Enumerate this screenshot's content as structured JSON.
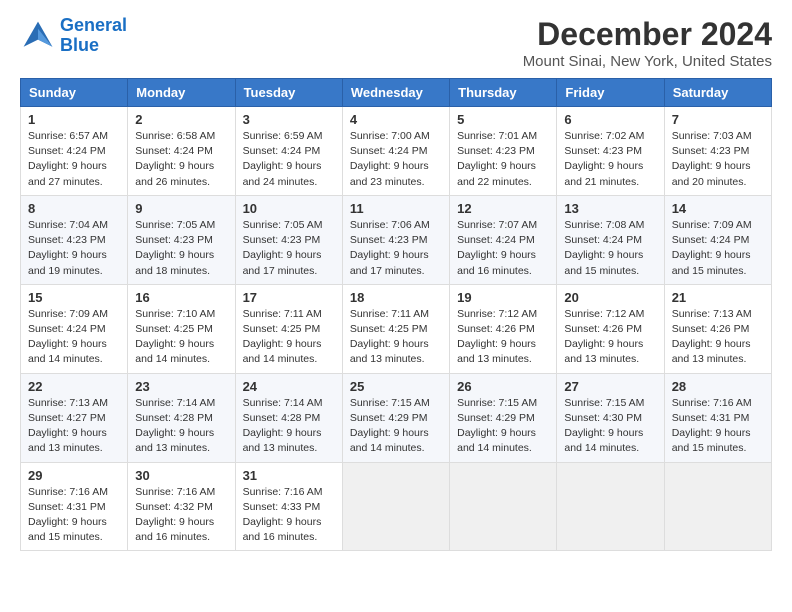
{
  "header": {
    "logo_line1": "General",
    "logo_line2": "Blue",
    "title": "December 2024",
    "subtitle": "Mount Sinai, New York, United States"
  },
  "calendar": {
    "days_of_week": [
      "Sunday",
      "Monday",
      "Tuesday",
      "Wednesday",
      "Thursday",
      "Friday",
      "Saturday"
    ],
    "weeks": [
      [
        {
          "day": "1",
          "sunrise": "6:57 AM",
          "sunset": "4:24 PM",
          "daylight": "9 hours and 27 minutes."
        },
        {
          "day": "2",
          "sunrise": "6:58 AM",
          "sunset": "4:24 PM",
          "daylight": "9 hours and 26 minutes."
        },
        {
          "day": "3",
          "sunrise": "6:59 AM",
          "sunset": "4:24 PM",
          "daylight": "9 hours and 24 minutes."
        },
        {
          "day": "4",
          "sunrise": "7:00 AM",
          "sunset": "4:24 PM",
          "daylight": "9 hours and 23 minutes."
        },
        {
          "day": "5",
          "sunrise": "7:01 AM",
          "sunset": "4:23 PM",
          "daylight": "9 hours and 22 minutes."
        },
        {
          "day": "6",
          "sunrise": "7:02 AM",
          "sunset": "4:23 PM",
          "daylight": "9 hours and 21 minutes."
        },
        {
          "day": "7",
          "sunrise": "7:03 AM",
          "sunset": "4:23 PM",
          "daylight": "9 hours and 20 minutes."
        }
      ],
      [
        {
          "day": "8",
          "sunrise": "7:04 AM",
          "sunset": "4:23 PM",
          "daylight": "9 hours and 19 minutes."
        },
        {
          "day": "9",
          "sunrise": "7:05 AM",
          "sunset": "4:23 PM",
          "daylight": "9 hours and 18 minutes."
        },
        {
          "day": "10",
          "sunrise": "7:05 AM",
          "sunset": "4:23 PM",
          "daylight": "9 hours and 17 minutes."
        },
        {
          "day": "11",
          "sunrise": "7:06 AM",
          "sunset": "4:23 PM",
          "daylight": "9 hours and 17 minutes."
        },
        {
          "day": "12",
          "sunrise": "7:07 AM",
          "sunset": "4:24 PM",
          "daylight": "9 hours and 16 minutes."
        },
        {
          "day": "13",
          "sunrise": "7:08 AM",
          "sunset": "4:24 PM",
          "daylight": "9 hours and 15 minutes."
        },
        {
          "day": "14",
          "sunrise": "7:09 AM",
          "sunset": "4:24 PM",
          "daylight": "9 hours and 15 minutes."
        }
      ],
      [
        {
          "day": "15",
          "sunrise": "7:09 AM",
          "sunset": "4:24 PM",
          "daylight": "9 hours and 14 minutes."
        },
        {
          "day": "16",
          "sunrise": "7:10 AM",
          "sunset": "4:25 PM",
          "daylight": "9 hours and 14 minutes."
        },
        {
          "day": "17",
          "sunrise": "7:11 AM",
          "sunset": "4:25 PM",
          "daylight": "9 hours and 14 minutes."
        },
        {
          "day": "18",
          "sunrise": "7:11 AM",
          "sunset": "4:25 PM",
          "daylight": "9 hours and 13 minutes."
        },
        {
          "day": "19",
          "sunrise": "7:12 AM",
          "sunset": "4:26 PM",
          "daylight": "9 hours and 13 minutes."
        },
        {
          "day": "20",
          "sunrise": "7:12 AM",
          "sunset": "4:26 PM",
          "daylight": "9 hours and 13 minutes."
        },
        {
          "day": "21",
          "sunrise": "7:13 AM",
          "sunset": "4:26 PM",
          "daylight": "9 hours and 13 minutes."
        }
      ],
      [
        {
          "day": "22",
          "sunrise": "7:13 AM",
          "sunset": "4:27 PM",
          "daylight": "9 hours and 13 minutes."
        },
        {
          "day": "23",
          "sunrise": "7:14 AM",
          "sunset": "4:28 PM",
          "daylight": "9 hours and 13 minutes."
        },
        {
          "day": "24",
          "sunrise": "7:14 AM",
          "sunset": "4:28 PM",
          "daylight": "9 hours and 13 minutes."
        },
        {
          "day": "25",
          "sunrise": "7:15 AM",
          "sunset": "4:29 PM",
          "daylight": "9 hours and 14 minutes."
        },
        {
          "day": "26",
          "sunrise": "7:15 AM",
          "sunset": "4:29 PM",
          "daylight": "9 hours and 14 minutes."
        },
        {
          "day": "27",
          "sunrise": "7:15 AM",
          "sunset": "4:30 PM",
          "daylight": "9 hours and 14 minutes."
        },
        {
          "day": "28",
          "sunrise": "7:16 AM",
          "sunset": "4:31 PM",
          "daylight": "9 hours and 15 minutes."
        }
      ],
      [
        {
          "day": "29",
          "sunrise": "7:16 AM",
          "sunset": "4:31 PM",
          "daylight": "9 hours and 15 minutes."
        },
        {
          "day": "30",
          "sunrise": "7:16 AM",
          "sunset": "4:32 PM",
          "daylight": "9 hours and 16 minutes."
        },
        {
          "day": "31",
          "sunrise": "7:16 AM",
          "sunset": "4:33 PM",
          "daylight": "9 hours and 16 minutes."
        },
        null,
        null,
        null,
        null
      ]
    ]
  }
}
